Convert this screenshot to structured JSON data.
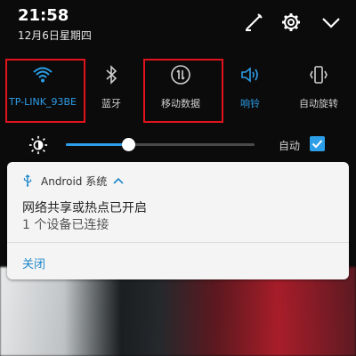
{
  "status": {
    "time": "21:58",
    "date": "12月6日星期四",
    "icons": [
      "edit-icon",
      "settings-gear-icon",
      "chevron-down-icon"
    ]
  },
  "quick_settings": {
    "tiles": [
      {
        "id": "wifi",
        "label": "TP-LINK_93BE",
        "icon": "wifi-icon",
        "active": true,
        "highlighted": true
      },
      {
        "id": "bluetooth",
        "label": "蓝牙",
        "icon": "bluetooth-icon",
        "active": false,
        "highlighted": false
      },
      {
        "id": "mobile-data",
        "label": "移动数据",
        "icon": "mobile-data-icon",
        "active": false,
        "highlighted": true
      },
      {
        "id": "ringer",
        "label": "响铃",
        "icon": "speaker-icon",
        "active": true,
        "highlighted": false
      },
      {
        "id": "auto-rotate",
        "label": "自动旋转",
        "icon": "rotate-phone-icon",
        "active": false,
        "highlighted": false
      }
    ]
  },
  "brightness": {
    "icon": "brightness-sun-icon",
    "level_percent": 33,
    "auto_label": "自动",
    "auto_checked": true
  },
  "notification": {
    "app_icon": "usb-icon",
    "app_name": "Android 系统",
    "title": "网络共享或热点已开启",
    "text": "1 个设备已连接",
    "action": "关闭"
  },
  "colors": {
    "accent": "#2d9ee8",
    "highlight_border": "#e0131c",
    "panel_bg": "#0b0b0b",
    "notification_bg": "#f4f4f4"
  }
}
